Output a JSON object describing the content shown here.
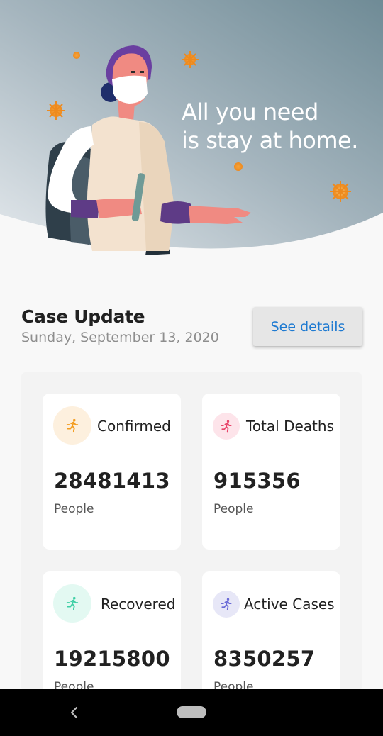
{
  "hero": {
    "headline_line1": "All you need",
    "headline_line2": "is stay at home.",
    "gradient": [
      "#e3e8ec",
      "#9fb0ba",
      "#6f8b96"
    ],
    "virus_color": "#f59b2f"
  },
  "case_update": {
    "title": "Case Update",
    "date": "Sunday, September 13, 2020",
    "details_button": "See details",
    "link_color": "#1e7ad1"
  },
  "stats": [
    {
      "label": "Confirmed",
      "value": "28481413",
      "unit": "People",
      "icon": "running-person-icon",
      "accent": "#f39c1e",
      "bg": "#fdf0de"
    },
    {
      "label": "Total Deaths",
      "value": "915356",
      "unit": "People",
      "icon": "running-person-icon",
      "accent": "#e8456a",
      "bg": "#fde4ea"
    },
    {
      "label": "Recovered",
      "value": "19215800",
      "unit": "People",
      "icon": "running-person-icon",
      "accent": "#3fcfa5",
      "bg": "#e3f9f2"
    },
    {
      "label": "Active Cases",
      "value": "8350257",
      "unit": "People",
      "icon": "running-person-icon",
      "accent": "#6a6ad6",
      "bg": "#e7e7f7"
    }
  ],
  "navbar": {
    "back_icon": "back-chevron-icon",
    "home_icon": "home-pill-icon"
  }
}
